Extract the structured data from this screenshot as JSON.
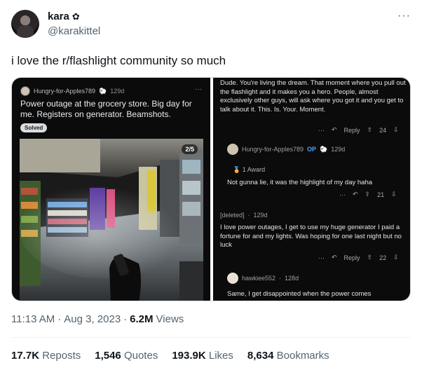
{
  "author": {
    "display_name": "kara",
    "name_icon": "flower-icon",
    "handle": "@karakittel"
  },
  "tweet": {
    "text": "i love the r/flashlight community so much"
  },
  "post": {
    "username": "Hungry-for-Apples789",
    "badge": "🐑",
    "time": "129d",
    "title": "Power outage at the grocery store. Big day for me. Registers on generator. Beamshots.",
    "flair": "Solved",
    "photo_counter": "2/5"
  },
  "comments": {
    "c1_text": "Dude. You're living the dream.  That moment where you pull out the flashlight and it makes you a hero. People, almost exclusively other guys, will ask where you got it and you get to talk about it.  This. Is. Your. Moment.",
    "c1_reply": "Reply",
    "c1_votes": "24",
    "c2_user": "Hungry-for-Apples789",
    "c2_op": "OP",
    "c2_badge": "🐑",
    "c2_time": "129d",
    "c2_award": "1 Award",
    "c2_text": "Not gunna lie, it was the highlight of my day haha",
    "c2_votes": "21",
    "c3_user": "[deleted]",
    "c3_time": "129d",
    "c3_text": "I love power outages, I get to use my huge generator I paid a fortune for and my lights. Was hoping for one last night but no luck",
    "c3_reply": "Reply",
    "c3_votes": "22",
    "c4_user": "hawkiee552",
    "c4_time": "128d",
    "c4_text": "Same, I get disappointed when the power comes"
  },
  "meta": {
    "time": "11:13 AM",
    "date": "Aug 3, 2023",
    "views_count": "6.2M",
    "views_label": "Views"
  },
  "stats": {
    "reposts_count": "17.7K",
    "reposts_label": "Reposts",
    "quotes_count": "1,546",
    "quotes_label": "Quotes",
    "likes_count": "193.9K",
    "likes_label": "Likes",
    "bookmarks_count": "8,634",
    "bookmarks_label": "Bookmarks"
  }
}
